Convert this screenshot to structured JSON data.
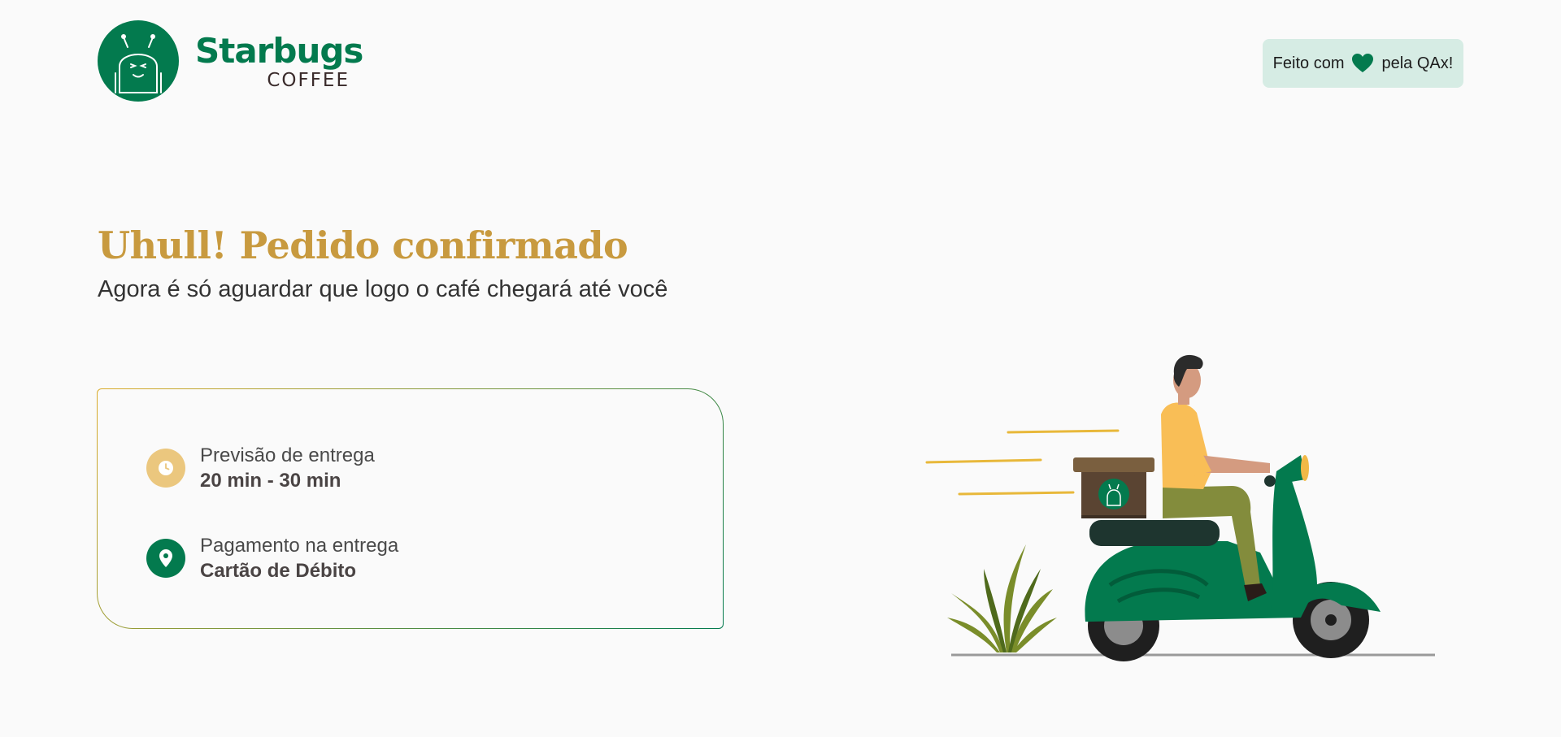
{
  "header": {
    "logo": {
      "brand": "Starbugs",
      "sub": "COFFEE",
      "icon": "robot-mascot-icon"
    },
    "credit": {
      "prefix": "Feito com",
      "icon": "heart-icon",
      "suffix": "pela QAx!"
    }
  },
  "hero": {
    "title": "Uhull! Pedido confirmado",
    "subtitle": "Agora é só aguardar que logo o café chegará até você"
  },
  "order_info": {
    "delivery": {
      "icon": "clock-icon",
      "label": "Previsão de entrega",
      "value": "20 min - 30 min"
    },
    "payment": {
      "icon": "location-pin-icon",
      "label": "Pagamento na entrega",
      "value": "Cartão de Débito"
    }
  },
  "illustration": {
    "subject": "delivery-scooter-illustration"
  },
  "colors": {
    "brand_green": "#037a4e",
    "gold": "#c89a3f",
    "clock_badge": "#ebc77e",
    "credit_bg": "#d6ece4"
  }
}
